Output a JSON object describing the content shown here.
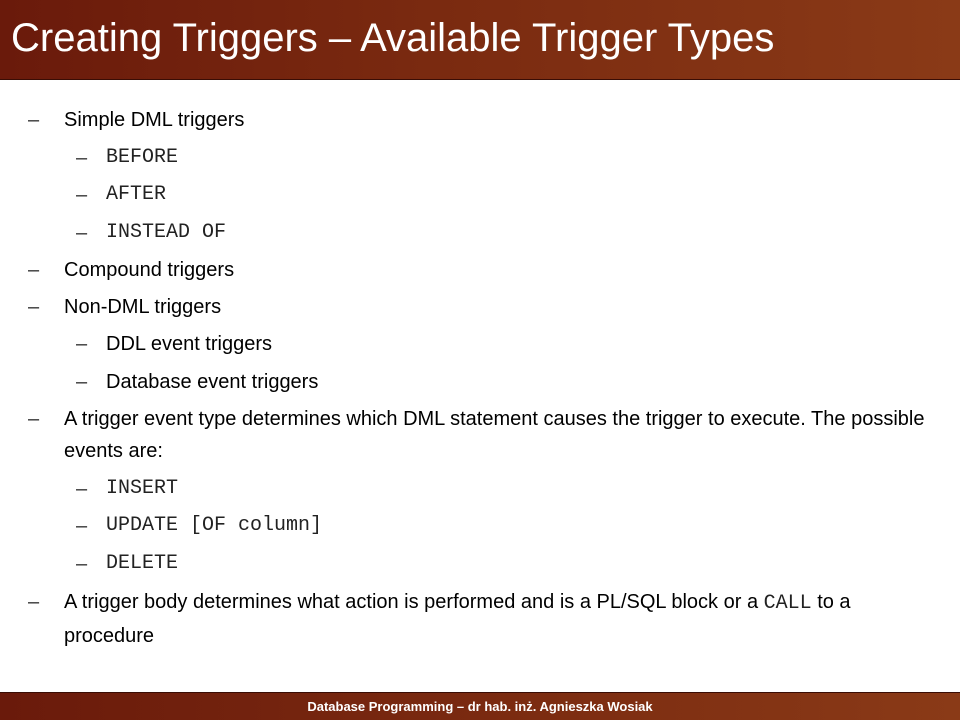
{
  "slide": {
    "title": "Creating Triggers – Available Trigger Types",
    "footer": "Database Programming – dr hab. inż. Agnieszka Wosiak"
  },
  "bullets": {
    "dash": "–",
    "simple_dml": "Simple DML triggers",
    "before": "BEFORE",
    "after": "AFTER",
    "instead_of": "INSTEAD OF",
    "compound": "Compound triggers",
    "non_dml": "Non-DML triggers",
    "ddl_event": "DDL event triggers",
    "db_event": "Database event triggers",
    "event_type": "A trigger event type determines which DML statement causes the trigger to execute. The possible events are:",
    "insert": "INSERT",
    "update": "UPDATE [OF column]",
    "delete": "DELETE",
    "body_part1": "A trigger body determines what action is performed and is a PL/SQL block or a ",
    "body_call": "CALL",
    "body_part2": " to a procedure"
  },
  "colors": {
    "title_bar": "#7a2a10",
    "title_text": "#ffffff",
    "footer_bar": "#7a2a10"
  }
}
